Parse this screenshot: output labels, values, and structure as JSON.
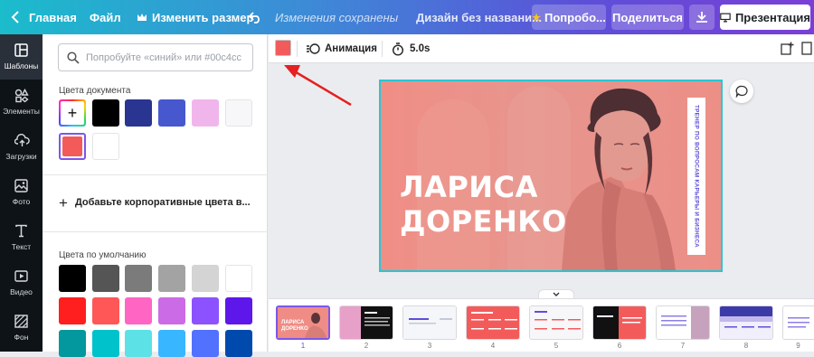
{
  "topbar": {
    "home": "Главная",
    "file": "Файл",
    "resize": "Изменить размер",
    "saved_status": "Изменения сохранены",
    "design_title": "Дизайн без названи...",
    "pro_button": "Попробо...",
    "share_button": "Поделиться",
    "present_button": "Презентация"
  },
  "nav": {
    "templates": "Шаблоны",
    "elements": "Элементы",
    "uploads": "Загрузки",
    "photos": "Фото",
    "text": "Текст",
    "video": "Видео",
    "background": "Фон"
  },
  "panel": {
    "search_placeholder": "Попробуйте «синий» или #00c4cc",
    "document_colors_title": "Цвета документа",
    "document_colors": [
      "#000000",
      "#2a3591",
      "#4758cf",
      "#f0b6ec",
      "#f7f7f9"
    ],
    "selected_color": "#f35b5b",
    "add_brand_colors": "Добавьте корпоративные цвета в...",
    "default_colors_title": "Цвета по умолчанию",
    "default_colors_row1": [
      "#000000",
      "#555555",
      "#7b7b7b",
      "#a3a3a3",
      "#d4d4d4",
      "#ffffff"
    ],
    "default_colors_row2": [
      "#ff1f1f",
      "#ff5757",
      "#ff66c4",
      "#cb6ce6",
      "#8c52ff",
      "#5e17eb"
    ],
    "default_colors_row3": [
      "#03989e",
      "#00c2cb",
      "#5ce1e6",
      "#38b6ff",
      "#5271ff",
      "#004aad"
    ]
  },
  "toolbar": {
    "color_value": "#f35b5b",
    "animation": "Анимация",
    "duration": "5.0s"
  },
  "slide": {
    "name_line1": "ЛАРИСА",
    "name_line2": "ДОРЕНКО",
    "vertical_text": "ТРЕНЕР ПО ВОПРОСАМ КАРЬЕРЫ И БИЗНЕСА",
    "bg_color": "#f08a82"
  },
  "filmstrip": {
    "pages": [
      "1",
      "2",
      "3",
      "4",
      "5",
      "6",
      "7",
      "8",
      "9"
    ],
    "thumb1_line1": "ЛАРИСА",
    "thumb1_line2": "ДОРЕНКО"
  }
}
